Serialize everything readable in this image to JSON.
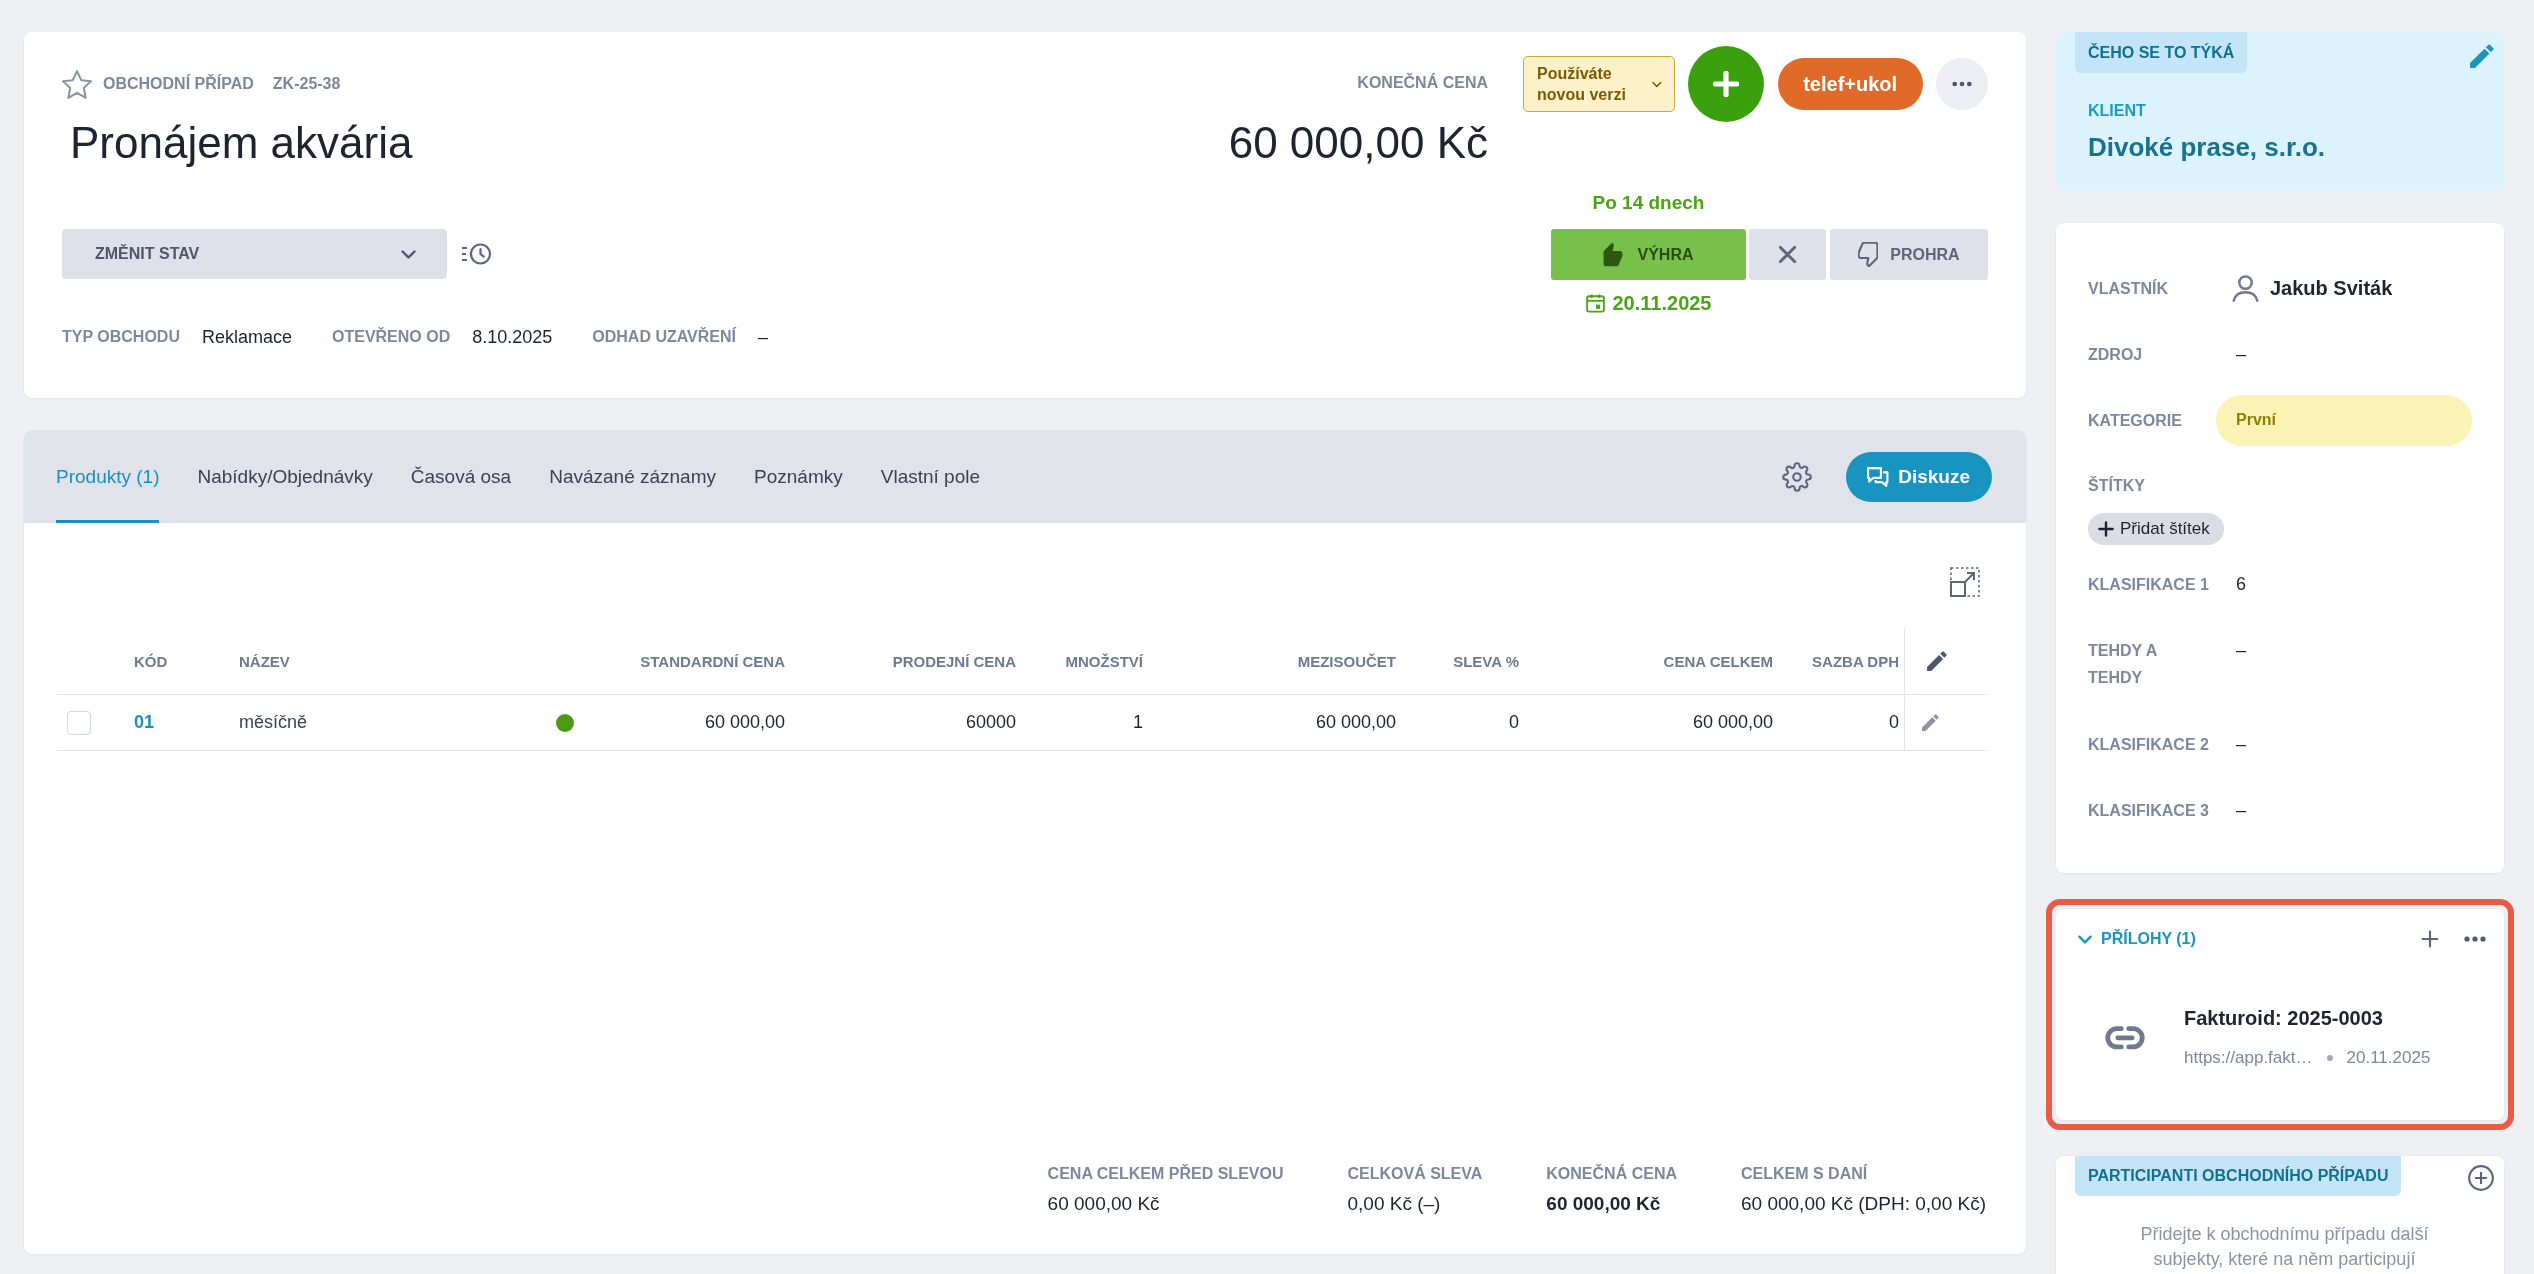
{
  "deal": {
    "starred": false,
    "type_label": "OBCHODNÍ PŘÍPAD",
    "code": "ZK-25-38",
    "title": "Pronájem akvária",
    "price_label": "KONEČNÁ CENA",
    "price": "60 000,00 Kč"
  },
  "header_actions": {
    "version_badge": "Používáte novou verzi",
    "quick_action": "telef+ukol"
  },
  "status_dropdown": {
    "label": "ZMĚNIT STAV"
  },
  "outcome": {
    "due": "Po 14 dnech",
    "win_label": "VÝHRA",
    "lose_label": "PROHRA",
    "date": "20.11.2025"
  },
  "meta": [
    {
      "label": "TYP OBCHODU",
      "value": "Reklamace"
    },
    {
      "label": "OTEVŘENO OD",
      "value": "8.10.2025"
    },
    {
      "label": "ODHAD UZAVŘENÍ",
      "value": "–"
    }
  ],
  "tabs": [
    {
      "label": "Produkty (1)",
      "selected": true
    },
    {
      "label": "Nabídky/Objednávky",
      "selected": false
    },
    {
      "label": "Časová osa",
      "selected": false
    },
    {
      "label": "Navázané záznamy",
      "selected": false
    },
    {
      "label": "Poznámky",
      "selected": false
    },
    {
      "label": "Vlastní pole",
      "selected": false
    }
  ],
  "discussion_button": {
    "label": "Diskuze"
  },
  "table": {
    "columns": [
      "KÓD",
      "NÁZEV",
      "STANDARDNÍ CENA",
      "PRODEJNÍ CENA",
      "MNOŽSTVÍ",
      "MEZISOUČET",
      "SLEVA %",
      "CENA CELKEM",
      "SAZBA DPH"
    ],
    "rows": [
      {
        "checked": false,
        "code": "01",
        "name": "měsíčně",
        "color": "#4a9a16",
        "values": [
          "60 000,00",
          "60000",
          "1",
          "60 000,00",
          "0",
          "60 000,00",
          "0"
        ]
      }
    ]
  },
  "totals": [
    {
      "label": "CENA CELKEM PŘED SLEVOU",
      "value": "60 000,00 Kč",
      "emphasized": false
    },
    {
      "label": "CELKOVÁ SLEVA",
      "value": "0,00 Kč (–)",
      "emphasized": false
    },
    {
      "label": "KONEČNÁ CENA",
      "value": "60 000,00 Kč",
      "emphasized": true
    },
    {
      "label": "CELKEM S DANÍ",
      "value": "60 000,00 Kč (DPH: 0,00 Kč)",
      "emphasized": false
    }
  ],
  "related": {
    "heading": "ČEHO SE TO TÝKÁ",
    "label": "KLIENT",
    "client": "Divoké prase, s.r.o."
  },
  "details": [
    {
      "kind": "person",
      "label": "VLASTNÍK",
      "value": "Jakub Sviták"
    },
    {
      "kind": "text",
      "label": "ZDROJ",
      "value": "–"
    },
    {
      "kind": "category",
      "label": "KATEGORIE",
      "value": "První"
    },
    {
      "kind": "tags",
      "label": "ŠTÍTKY",
      "button": "Přidat štítek"
    },
    {
      "kind": "text",
      "label": "KLASIFIKACE 1",
      "value": "6"
    },
    {
      "kind": "text",
      "label": "TEHDY A TEHDY",
      "value": "–"
    },
    {
      "kind": "text",
      "label": "KLASIFIKACE 2",
      "value": "–"
    },
    {
      "kind": "text",
      "label": "KLASIFIKACE 3",
      "value": "–"
    }
  ],
  "attachments": {
    "title": "PŘÍLOHY (1)",
    "expanded": true,
    "highlighted": true,
    "items": [
      {
        "name": "Fakturoid: 2025-0003",
        "url": "https://app.fakt…",
        "date": "20.11.2025"
      }
    ]
  },
  "participants": {
    "heading": "PARTICIPANTI OBCHODNÍHO PŘÍPADU",
    "empty_text": "Přidejte k obchodnímu případu další subjekty, které na něm participují"
  }
}
